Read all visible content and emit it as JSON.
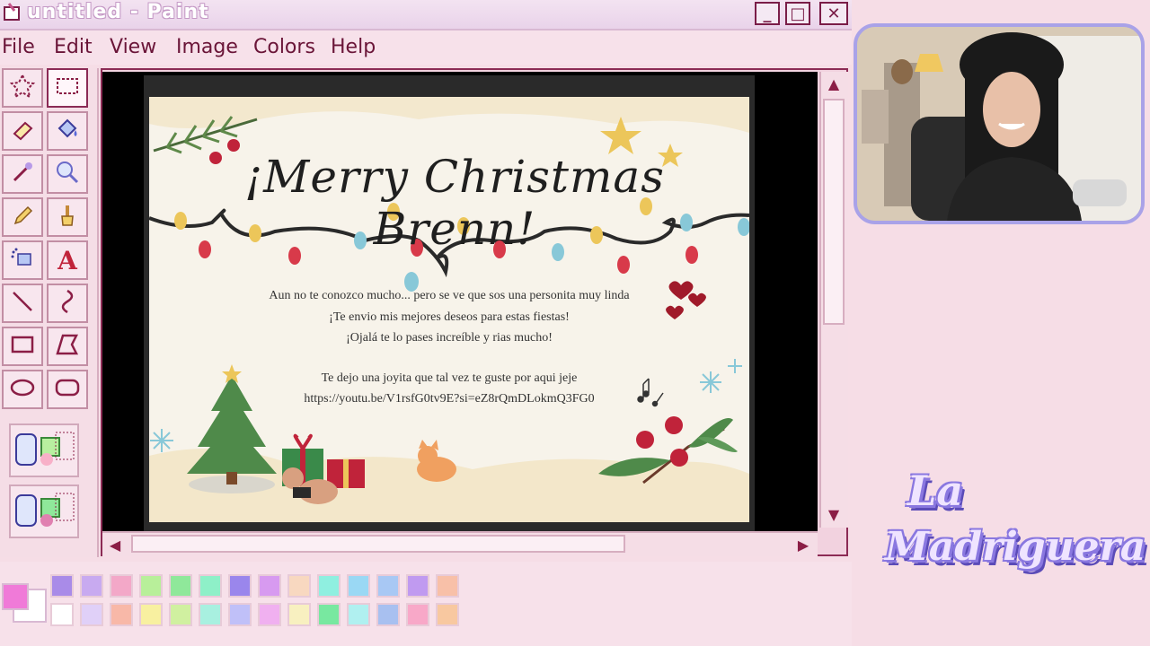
{
  "window": {
    "title": "untitled - Paint",
    "minimize_glyph": "_",
    "maximize_glyph": "□",
    "close_glyph": "✕"
  },
  "menu": {
    "items": [
      "File",
      "Edit",
      "View",
      "Image",
      "Colors",
      "Help"
    ]
  },
  "tools": [
    {
      "name": "free-select-icon"
    },
    {
      "name": "rect-select-icon"
    },
    {
      "name": "eraser-icon"
    },
    {
      "name": "fill-bucket-icon"
    },
    {
      "name": "color-picker-icon"
    },
    {
      "name": "magnifier-icon"
    },
    {
      "name": "pencil-icon"
    },
    {
      "name": "brush-icon"
    },
    {
      "name": "airbrush-icon"
    },
    {
      "name": "text-icon",
      "glyph": "A"
    },
    {
      "name": "line-icon"
    },
    {
      "name": "curve-icon"
    },
    {
      "name": "rectangle-icon"
    },
    {
      "name": "polygon-icon"
    },
    {
      "name": "ellipse-icon"
    },
    {
      "name": "rounded-rect-icon"
    }
  ],
  "card": {
    "title": "¡Merry Christmas Brenn!",
    "lines": [
      "Aun no te conozco mucho... pero se ve que sos una personita muy linda",
      "¡Te envio mis mejores deseos para estas fiestas!",
      "¡Ojalá te lo pases increíble y rias mucho!",
      "Te dejo una joyita que tal vez te guste por aqui jeje",
      "https://youtu.be/V1rsfG0tv9E?si=eZ8rQmDLokmQ3FG0"
    ]
  },
  "palette": {
    "foreground": "#f07ad8",
    "background": "#ffffff",
    "row1": [
      "#a98be8",
      "#c8aaf0",
      "#f3a8c8",
      "#b8ef9a",
      "#8fe89a",
      "#8ef0c8",
      "#9a86ec",
      "#d79af0",
      "#f8d8c0",
      "#8fefe0",
      "#9ad8f4",
      "#a8c8f4",
      "#c09af0",
      "#f8c0a8"
    ],
    "row2": [
      "#ffffff",
      "#e0d0f8",
      "#f8b8a8",
      "#f8f0a0",
      "#d0f0a0",
      "#a8f0e0",
      "#c0c0f8",
      "#f0b0f0",
      "#f8f0c0",
      "#78e8a0",
      "#b0f0f0",
      "#a8c0f0",
      "#f8a8c8",
      "#f8c8a0"
    ]
  },
  "logo": {
    "line1": "La",
    "line2": "Madriguera"
  },
  "colors": {
    "accent": "#8b1e46",
    "window_bg": "#f6dde6",
    "webcam_border": "#a9a2e8"
  }
}
